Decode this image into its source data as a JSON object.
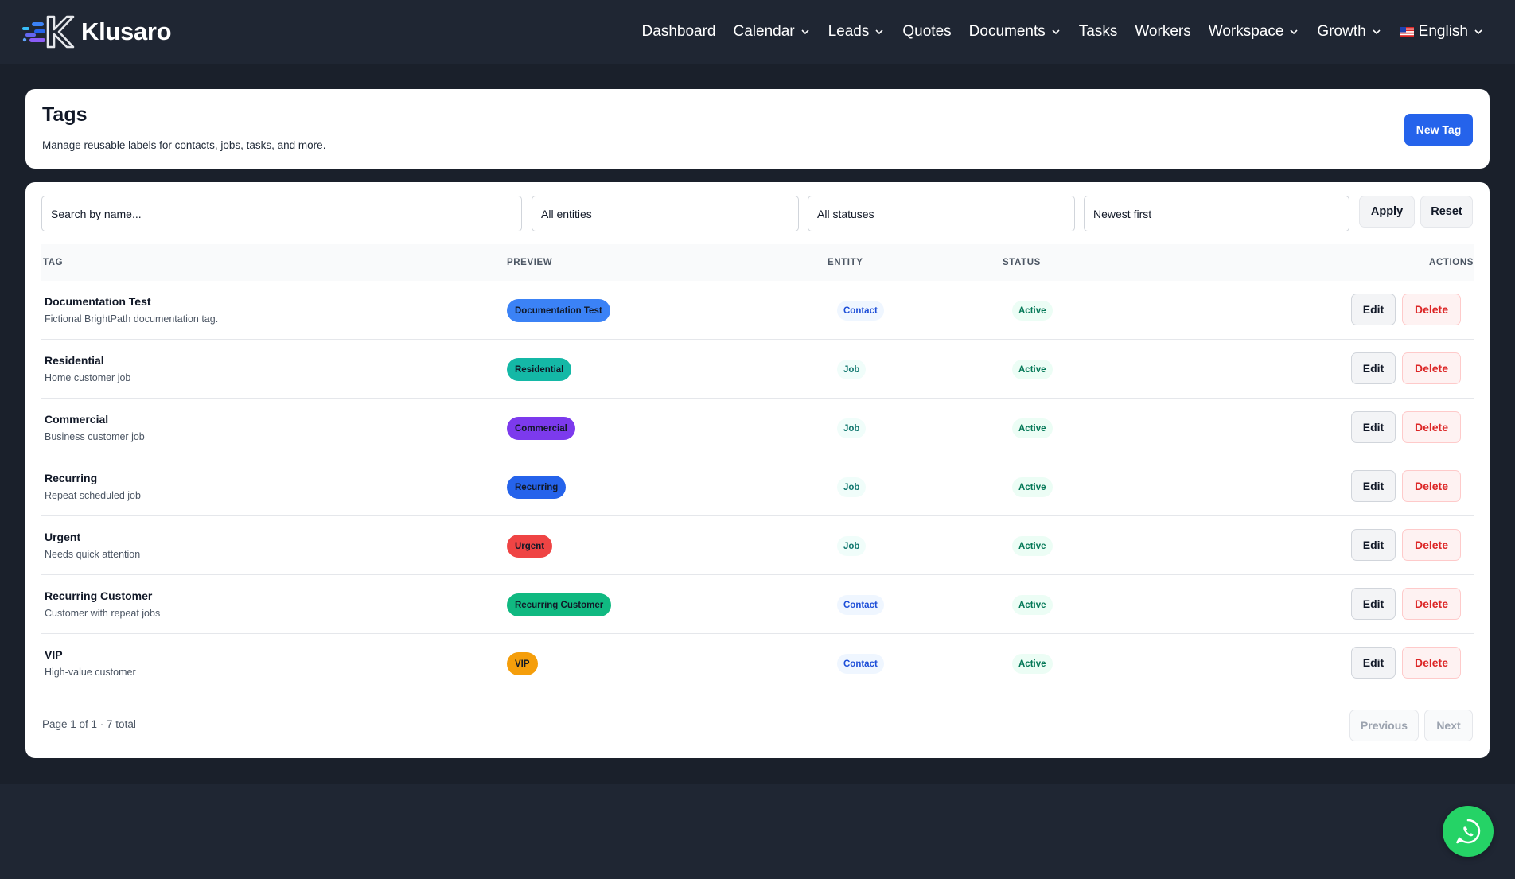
{
  "brand": {
    "name": "Klusaro"
  },
  "nav": {
    "items": [
      {
        "label": "Dashboard",
        "dropdown": false
      },
      {
        "label": "Calendar",
        "dropdown": true
      },
      {
        "label": "Leads",
        "dropdown": true
      },
      {
        "label": "Quotes",
        "dropdown": false
      },
      {
        "label": "Documents",
        "dropdown": true
      },
      {
        "label": "Tasks",
        "dropdown": false
      },
      {
        "label": "Workers",
        "dropdown": false
      },
      {
        "label": "Workspace",
        "dropdown": true
      },
      {
        "label": "Growth",
        "dropdown": true
      }
    ],
    "language": "English"
  },
  "header": {
    "title": "Tags",
    "subtitle": "Manage reusable labels for contacts, jobs, tasks, and more.",
    "new_button": "New Tag"
  },
  "filters": {
    "search_placeholder": "Search by name...",
    "entity": "All entities",
    "status": "All statuses",
    "sort": "Newest first",
    "apply": "Apply",
    "reset": "Reset"
  },
  "table": {
    "columns": {
      "tag": "TAG",
      "preview": "PREVIEW",
      "entity": "ENTITY",
      "status": "STATUS",
      "actions": "ACTIONS"
    },
    "edit_label": "Edit",
    "delete_label": "Delete",
    "rows": [
      {
        "name": "Documentation Test",
        "description": "Fictional BrightPath documentation tag.",
        "preview": "Documentation Test",
        "color": "#3b82f6",
        "entity": "Contact",
        "status": "Active"
      },
      {
        "name": "Residential",
        "description": "Home customer job",
        "preview": "Residential",
        "color": "#14b8a6",
        "entity": "Job",
        "status": "Active"
      },
      {
        "name": "Commercial",
        "description": "Business customer job",
        "preview": "Commercial",
        "color": "#7c3aed",
        "entity": "Job",
        "status": "Active"
      },
      {
        "name": "Recurring",
        "description": "Repeat scheduled job",
        "preview": "Recurring",
        "color": "#2563eb",
        "entity": "Job",
        "status": "Active"
      },
      {
        "name": "Urgent",
        "description": "Needs quick attention",
        "preview": "Urgent",
        "color": "#ef4444",
        "entity": "Job",
        "status": "Active"
      },
      {
        "name": "Recurring Customer",
        "description": "Customer with repeat jobs",
        "preview": "Recurring Customer",
        "color": "#10b981",
        "entity": "Contact",
        "status": "Active"
      },
      {
        "name": "VIP",
        "description": "High-value customer",
        "preview": "VIP",
        "color": "#f59e0b",
        "entity": "Contact",
        "status": "Active"
      }
    ]
  },
  "pagination": {
    "info": "Page 1 of 1 · 7 total",
    "previous": "Previous",
    "next": "Next"
  },
  "colors": {
    "primary": "#2563eb",
    "danger": "#dc2626",
    "success_text": "#047857",
    "whatsapp": "#25d366"
  },
  "icons": [
    "logo-icon",
    "chevron-down-icon",
    "us-flag-icon",
    "whatsapp-icon"
  ]
}
